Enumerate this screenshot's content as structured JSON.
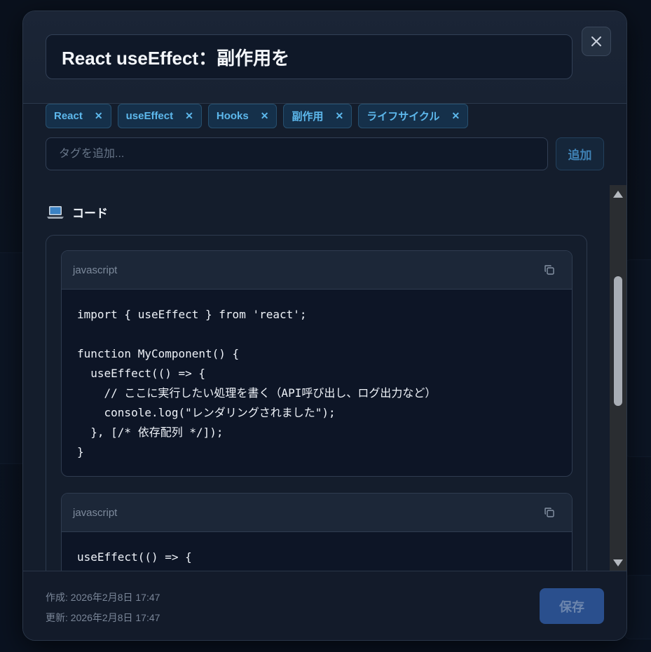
{
  "colors": {
    "accent": "#5db8ec",
    "modal_bg": "#141d2c",
    "save_button": "#2a4f8d"
  },
  "header": {
    "title": "React useEffect：副作用を",
    "close_icon": "close-icon"
  },
  "tags": [
    {
      "label": "React"
    },
    {
      "label": "useEffect"
    },
    {
      "label": "Hooks"
    },
    {
      "label": "副作用"
    },
    {
      "label": "ライフサイクル"
    }
  ],
  "tag_input": {
    "placeholder": "タグを追加...",
    "add_label": "追加"
  },
  "section": {
    "icon": "laptop-icon",
    "label": "コード"
  },
  "code_blocks": [
    {
      "language": "javascript",
      "lines": [
        "import { useEffect } from 'react';",
        "",
        "function MyComponent() {",
        "  useEffect(() => {",
        "    // ここに実行したい処理を書く（API呼び出し、ログ出力など）",
        "    console.log(\"レンダリングされました\");",
        "  }, [/* 依存配列 */]);",
        "}"
      ]
    },
    {
      "language": "javascript",
      "lines": [
        "useEffect(() => {"
      ]
    }
  ],
  "footer": {
    "created": "作成: 2026年2月8日 17:47",
    "updated": "更新: 2026年2月8日 17:47",
    "save_label": "保存"
  }
}
